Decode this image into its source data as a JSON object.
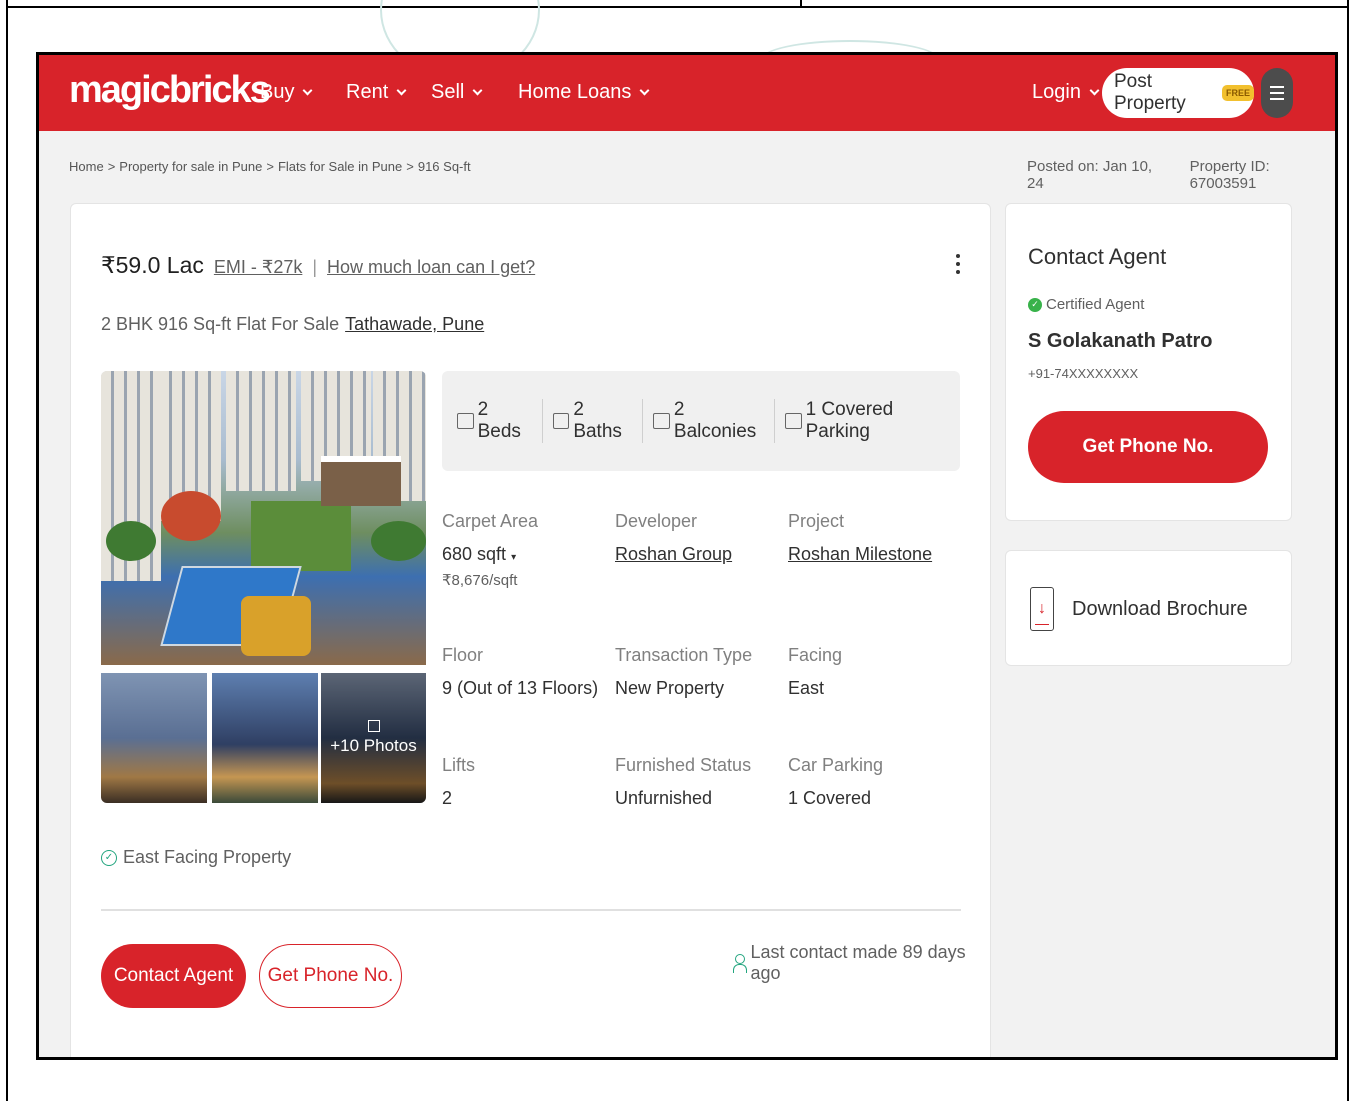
{
  "header": {
    "logo": "magicbricks",
    "nav": [
      {
        "label": "Buy"
      },
      {
        "label": "Rent"
      },
      {
        "label": "Sell"
      },
      {
        "label": "Home Loans"
      }
    ],
    "login": "Login",
    "post_property": "Post Property",
    "free_badge": "FREE"
  },
  "breadcrumb": {
    "items": [
      "Home",
      "Property for sale in Pune",
      "Flats for Sale in Pune",
      "916 Sq-ft"
    ],
    "separator": ">"
  },
  "meta": {
    "posted_on": "Posted on: Jan 10, 24",
    "property_id": "Property ID: 67003591"
  },
  "listing": {
    "price": "₹59.0 Lac",
    "emi": "EMI - ₹27k",
    "loan_link": "How much loan can I get?",
    "title": "2 BHK 916 Sq-ft Flat For Sale",
    "location": "Tathawade, Pune",
    "photos_more": "+10 Photos",
    "amenities": [
      {
        "icon": "bed-icon",
        "label": "2 Beds"
      },
      {
        "icon": "bath-icon",
        "label": "2 Baths"
      },
      {
        "icon": "balcony-icon",
        "label": "2 Balconies"
      },
      {
        "icon": "car-icon",
        "label": "1 Covered Parking"
      }
    ],
    "fields": {
      "carpet_area": {
        "label": "Carpet Area",
        "value": "680 sqft",
        "sub": "₹8,676/sqft"
      },
      "developer": {
        "label": "Developer",
        "value": "Roshan Group"
      },
      "project": {
        "label": "Project",
        "value": "Roshan Milestone"
      },
      "floor": {
        "label": "Floor",
        "value": "9 (Out of 13 Floors)"
      },
      "transaction": {
        "label": "Transaction Type",
        "value": "New Property"
      },
      "facing": {
        "label": "Facing",
        "value": "East"
      },
      "lifts": {
        "label": "Lifts",
        "value": "2"
      },
      "furnished": {
        "label": "Furnished Status",
        "value": "Unfurnished"
      },
      "car_parking": {
        "label": "Car Parking",
        "value": "1 Covered"
      }
    },
    "highlight": "East Facing Property",
    "contact_btn": "Contact Agent",
    "phone_btn": "Get Phone No.",
    "last_contact": "Last contact made 89 days ago"
  },
  "agent": {
    "heading": "Contact Agent",
    "certified": "Certified Agent",
    "name": "S Golakanath Patro",
    "phone": "+91-74XXXXXXXX",
    "phone_btn": "Get Phone No."
  },
  "brochure": {
    "label": "Download Brochure"
  },
  "colors": {
    "brand_red": "#d8232a",
    "accent_green": "#23a57f",
    "badge_yellow": "#f2c02e"
  }
}
